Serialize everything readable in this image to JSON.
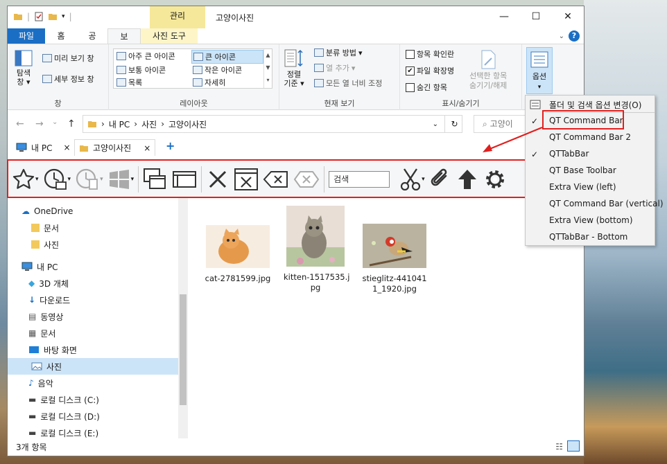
{
  "window": {
    "title": "고양이사진",
    "context_tab": "관리",
    "minimize": "—",
    "maximize": "☐",
    "close": "✕"
  },
  "ribbon_tabs": [
    "파일",
    "홈",
    "공유",
    "보기",
    "사진 도구"
  ],
  "help": "?",
  "ribbon": {
    "pane_group": {
      "label": "창",
      "nav_pane": "탐색\n창",
      "preview": "미리 보기 창",
      "details": "세부 정보 창"
    },
    "layout_group": {
      "label": "레이아웃",
      "items": [
        "아주 큰 아이콘",
        "큰 아이콘",
        "보통 아이콘",
        "작은 아이콘",
        "목록",
        "자세히"
      ]
    },
    "current_view_group": {
      "label": "현재 보기",
      "sort": "정렬\n기준",
      "group_by": "분류 방법",
      "add_columns": "열 추가",
      "fit_columns": "모든 열 너비 조정"
    },
    "show_hide_group": {
      "label": "표시/숨기기",
      "checkboxes": [
        {
          "label": "항목 확인란",
          "checked": false
        },
        {
          "label": "파일 확장명",
          "checked": true
        },
        {
          "label": "숨긴 항목",
          "checked": false
        }
      ],
      "hide_selected": "선택한 항목\n숨기기/해제"
    },
    "options": "옵션"
  },
  "address": {
    "path": [
      "내 PC",
      "사진",
      "고양이사진"
    ],
    "search_placeholder": "고양이",
    "refresh": "↻"
  },
  "qtabs": [
    {
      "label": "내 PC",
      "close": "×"
    },
    {
      "label": "고양이사진",
      "close": "×"
    }
  ],
  "qtab_add": "+",
  "command_bar": {
    "search_placeholder": "검색"
  },
  "nav_pane": {
    "items": [
      {
        "label": "OneDrive",
        "icon": "cloud-icon"
      },
      {
        "label": "문서",
        "icon": "folder-icon"
      },
      {
        "label": "사진",
        "icon": "folder-icon"
      },
      {
        "label": "내 PC",
        "icon": "pc-icon"
      },
      {
        "label": "3D 개체",
        "icon": "cube-icon"
      },
      {
        "label": "다운로드",
        "icon": "download-icon"
      },
      {
        "label": "동영상",
        "icon": "video-icon"
      },
      {
        "label": "문서",
        "icon": "document-icon"
      },
      {
        "label": "바탕 화면",
        "icon": "desktop-icon"
      },
      {
        "label": "사진",
        "icon": "picture-icon"
      },
      {
        "label": "음악",
        "icon": "music-icon"
      },
      {
        "label": "로컬 디스크 (C:)",
        "icon": "drive-icon"
      },
      {
        "label": "로컬 디스크 (D:)",
        "icon": "drive-icon"
      },
      {
        "label": "로컬 디스크 (E:)",
        "icon": "drive-icon"
      }
    ]
  },
  "files": [
    {
      "name": "cat-2781599.jpg"
    },
    {
      "name": "kitten-1517535.j\npg"
    },
    {
      "name": "stieglitz-441041\n1_1920.jpg"
    }
  ],
  "status": {
    "count": "3개 항목"
  },
  "options_menu": {
    "items": [
      {
        "label": "폴더 및 검색 옵션 변경(O)",
        "checked": false
      },
      {
        "label": "QT Command Bar",
        "checked": true
      },
      {
        "label": "QT Command Bar 2",
        "checked": false
      },
      {
        "label": "QTTabBar",
        "checked": true
      },
      {
        "label": "QT Base Toolbar",
        "checked": false
      },
      {
        "label": "Extra View (left)",
        "checked": false
      },
      {
        "label": "QT Command Bar (vertical)",
        "checked": false
      },
      {
        "label": "Extra View (bottom)",
        "checked": false
      },
      {
        "label": "QTTabBar - Bottom",
        "checked": false
      }
    ]
  },
  "colors": {
    "accent": "#1a6ec4",
    "highlight": "#e0201f",
    "selection": "#cce4f7"
  }
}
